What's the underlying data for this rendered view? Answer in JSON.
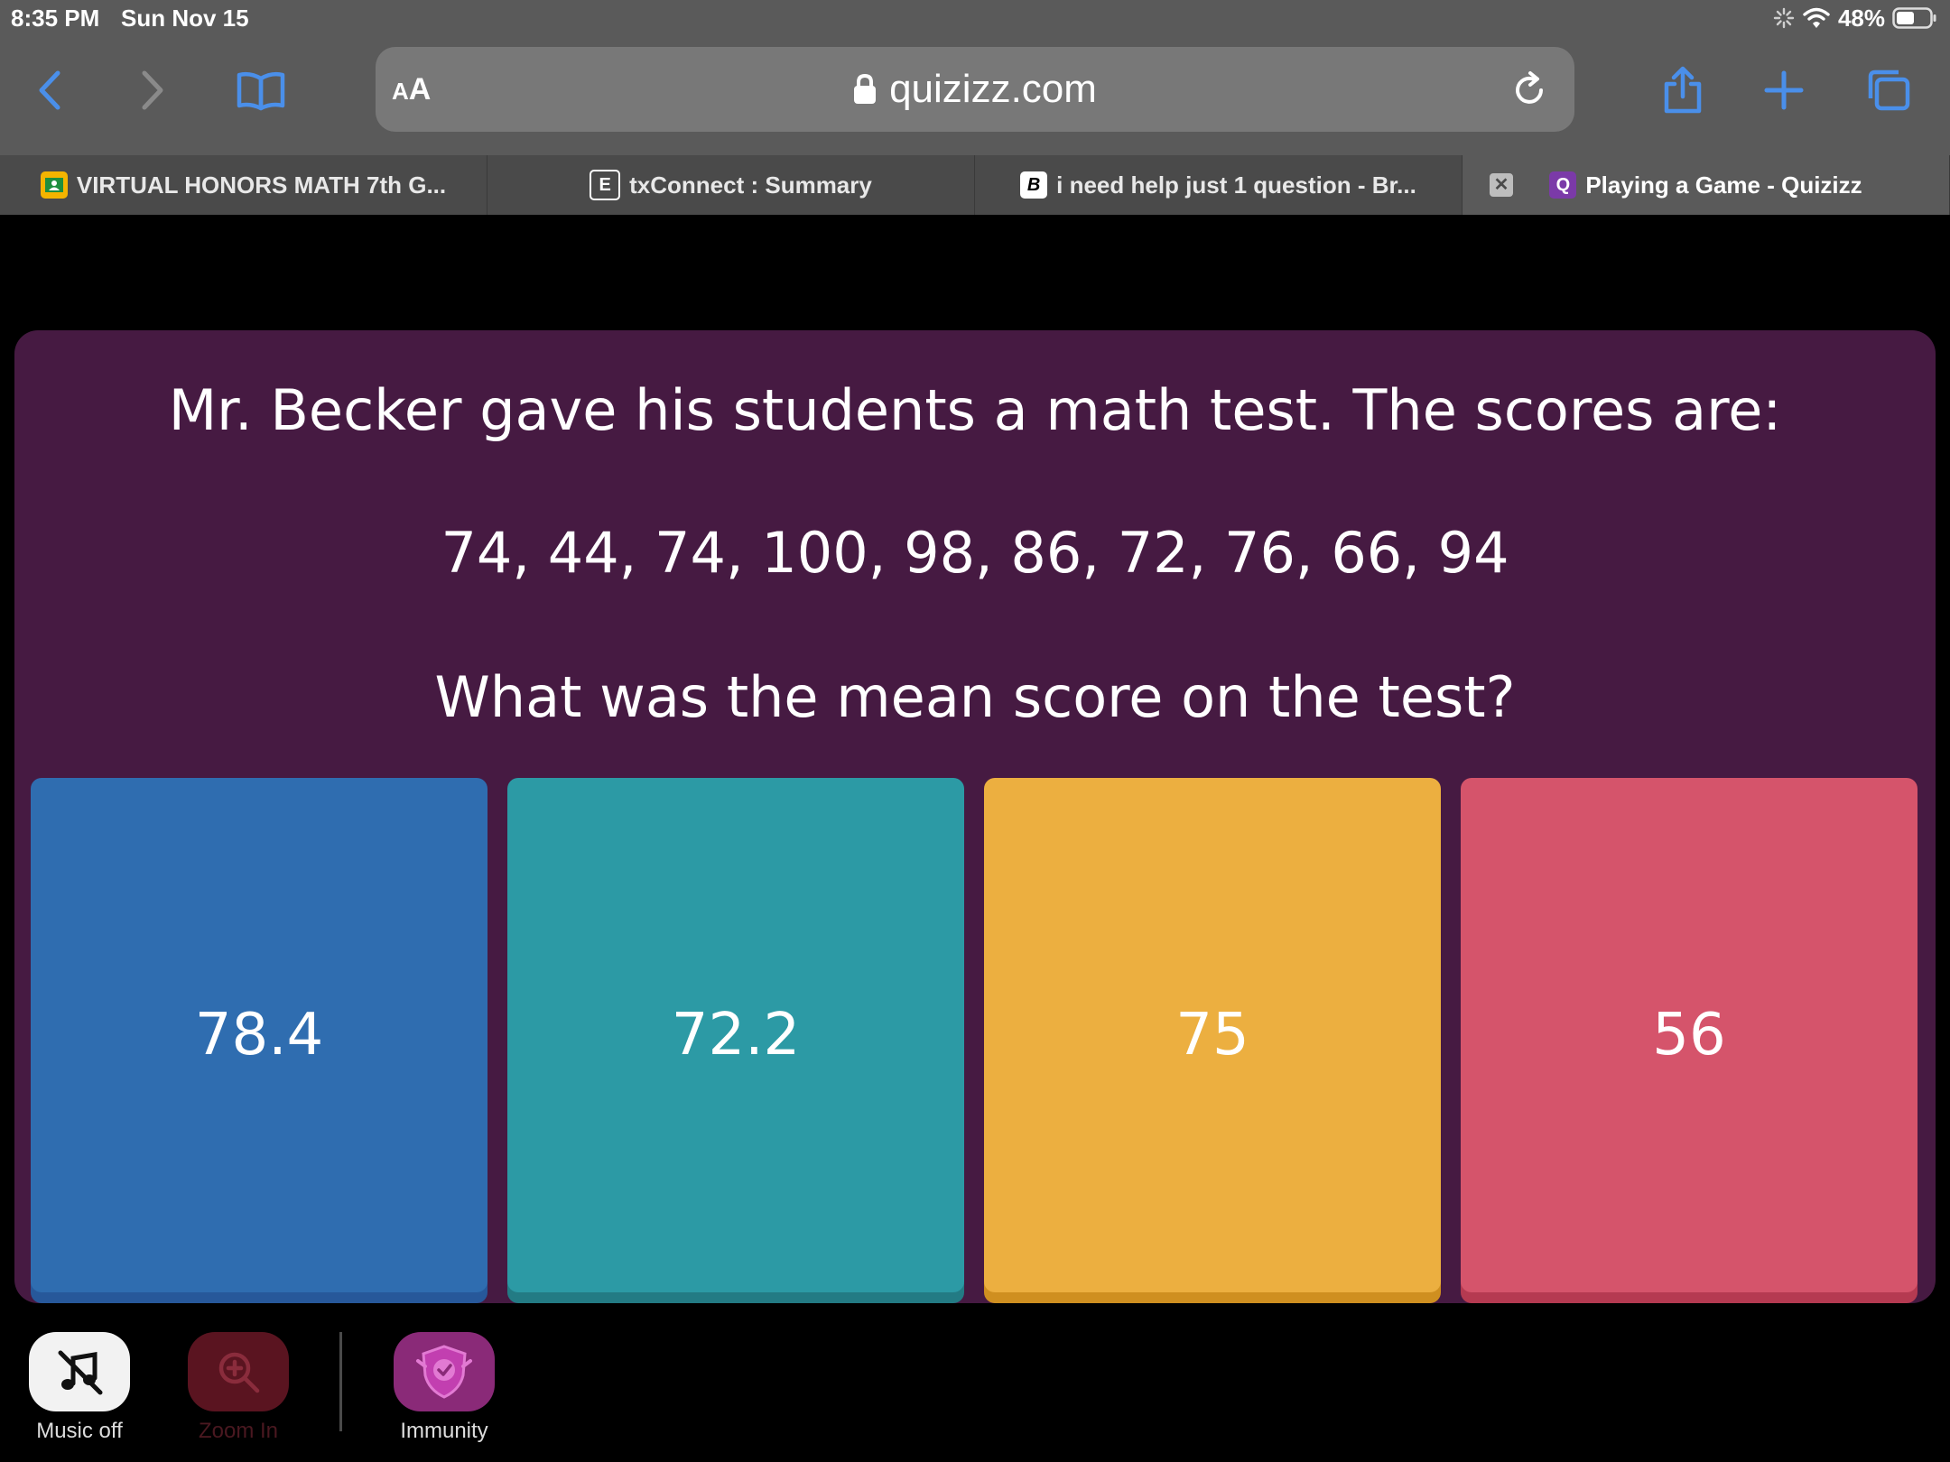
{
  "status_bar": {
    "time": "8:35 PM",
    "date": "Sun Nov 15",
    "battery": "48%"
  },
  "browser": {
    "aa_small": "A",
    "aa_big": "A",
    "url": "quizizz.com",
    "accent_color": "#4a8fea"
  },
  "tabs": [
    {
      "label": "VIRTUAL HONORS MATH 7th G...",
      "icon": "google-classroom-icon",
      "icon_color": "#f4b400"
    },
    {
      "label": "txConnect : Summary",
      "icon": "e-letter-icon",
      "icon_text": "E"
    },
    {
      "label": "i need help just 1 question - Br...",
      "icon": "brainly-b-icon",
      "icon_text": "B"
    },
    {
      "label": "Playing a Game - Quizizz",
      "icon": "quizizz-q-icon",
      "icon_text": "Q",
      "active": true
    }
  ],
  "question": {
    "line1": "Mr. Becker gave his students a math test. The scores are:",
    "line2": "74, 44, 74, 100, 98, 86, 72, 76, 66, 94",
    "line3": "What was the mean score on the test?"
  },
  "options": [
    {
      "label": "78.4",
      "color": "#2f6db0",
      "shade": "#27589a"
    },
    {
      "label": "72.2",
      "color": "#2c9aa5",
      "shade": "#237b84"
    },
    {
      "label": "75",
      "color": "#ecaf40",
      "shade": "#cf8f20"
    },
    {
      "label": "56",
      "color": "#d5546b",
      "shade": "#b53a51"
    }
  ],
  "controls": {
    "music": {
      "label": "Music off",
      "icon": "music-off-icon"
    },
    "zoom": {
      "label": "Zoom In",
      "icon": "zoom-in-icon"
    },
    "immunity": {
      "label": "Immunity",
      "icon": "immunity-shield-icon"
    }
  },
  "colors": {
    "quiz_background": "#461a42",
    "browser_chrome": "#5a5a5a"
  }
}
